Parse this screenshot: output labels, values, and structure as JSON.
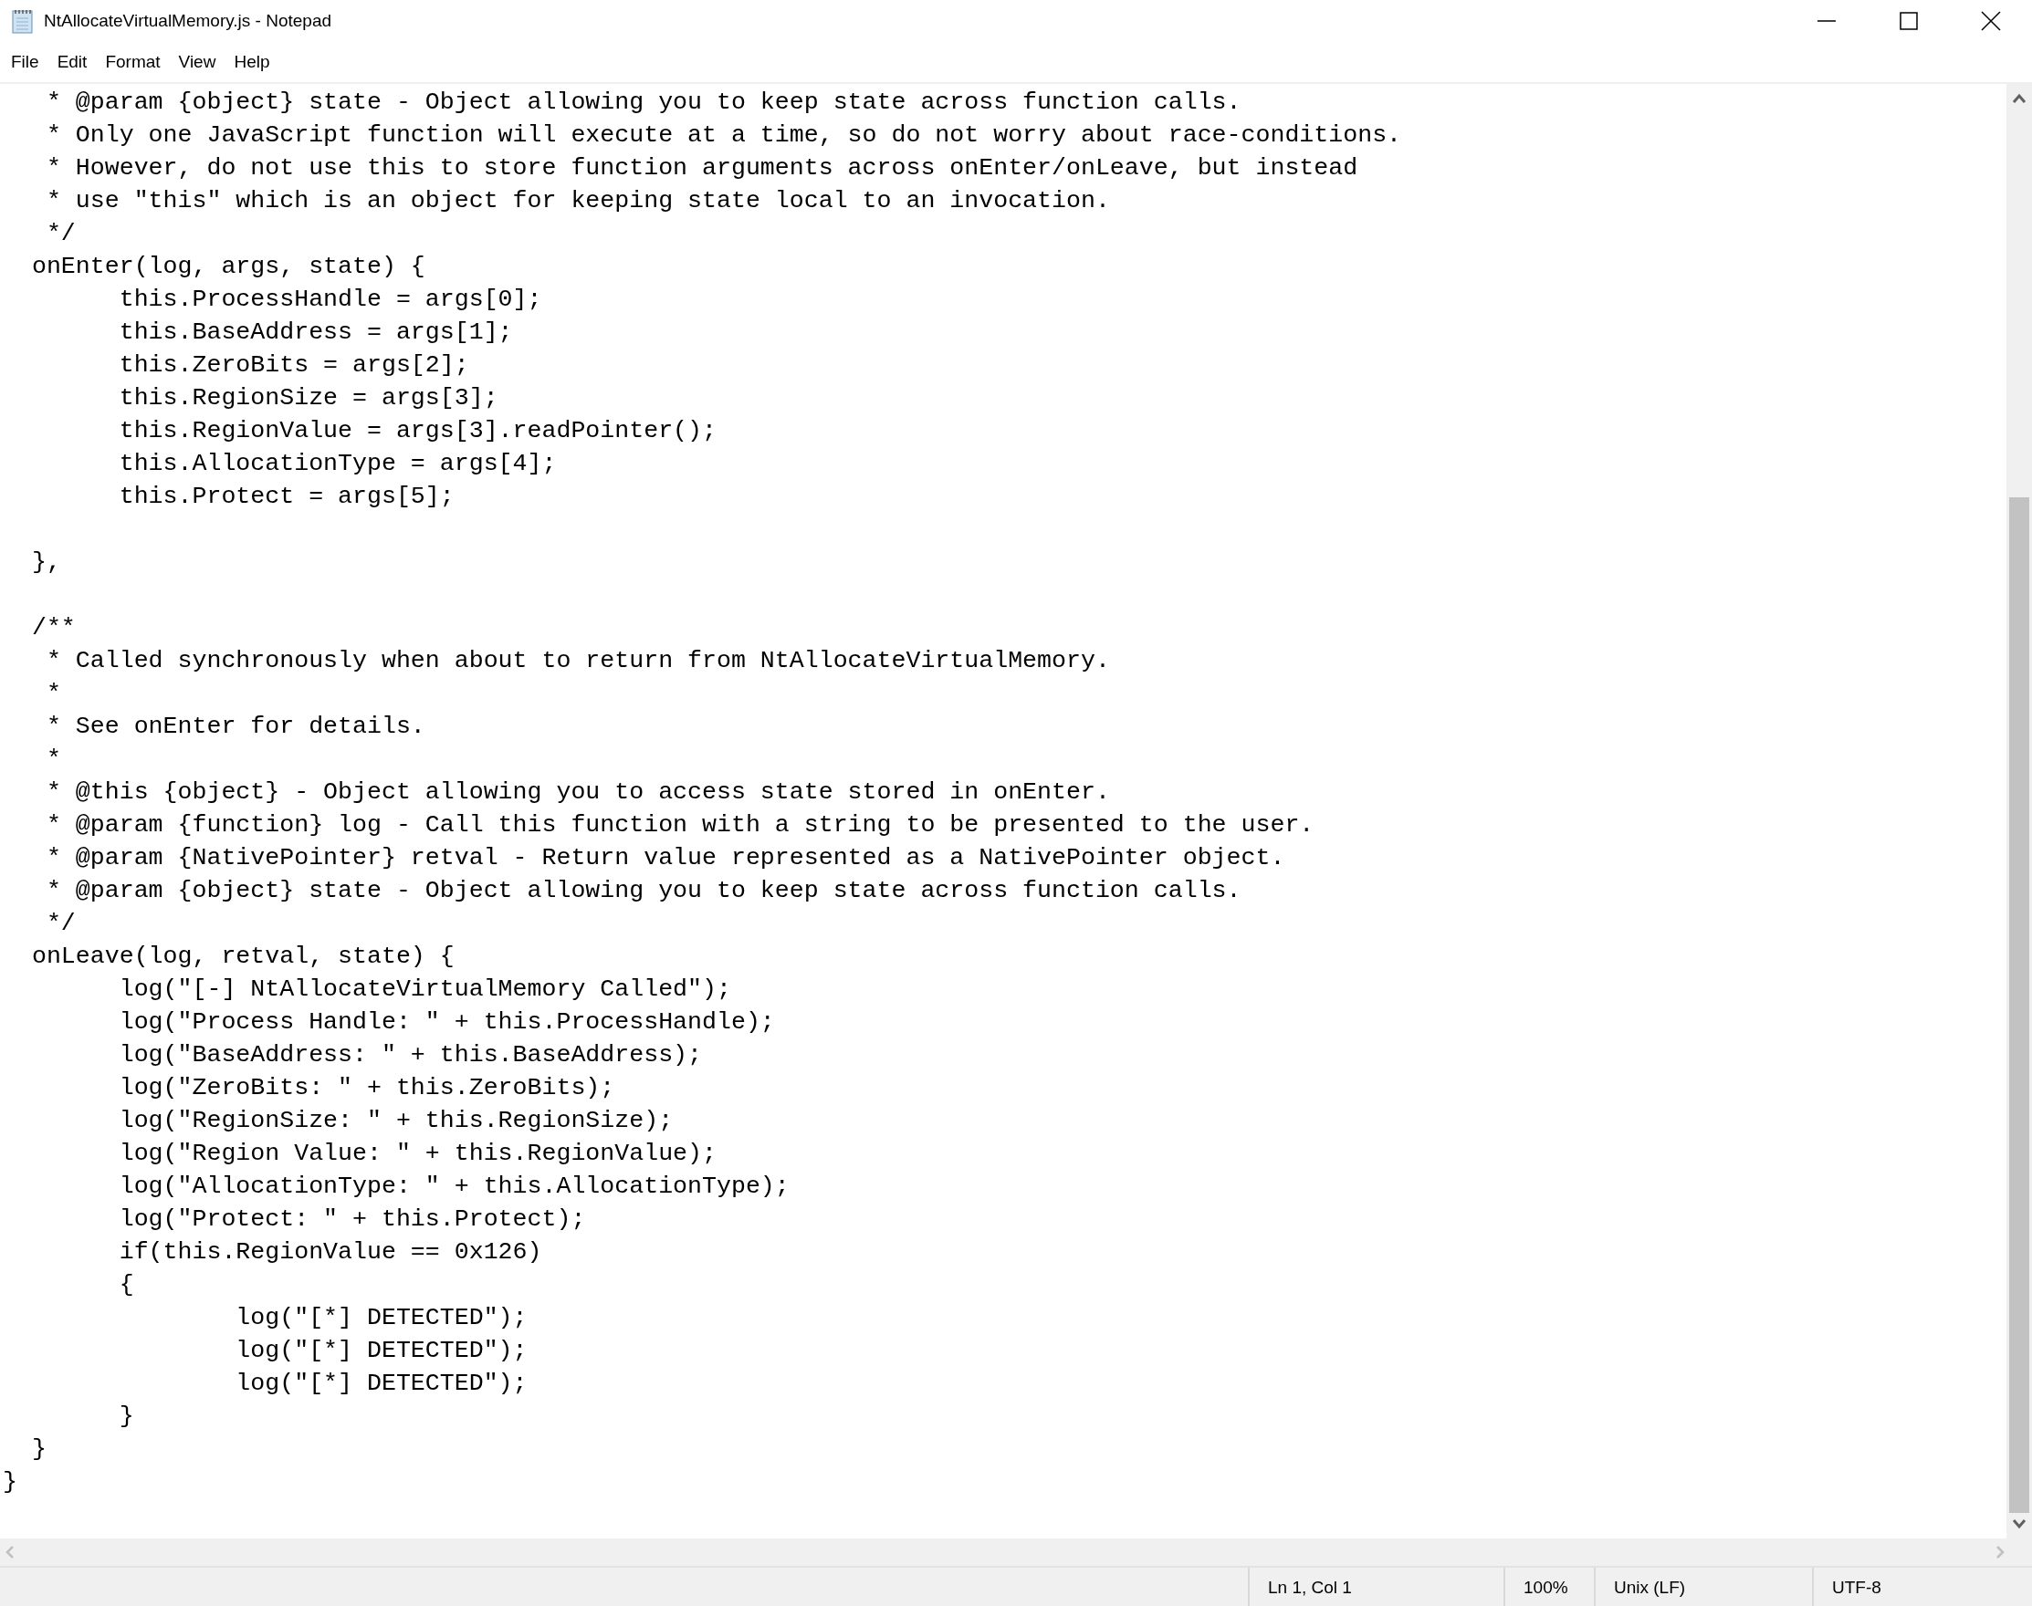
{
  "window": {
    "title": "NtAllocateVirtualMemory.js - Notepad"
  },
  "menu": [
    "File",
    "Edit",
    "Format",
    "View",
    "Help"
  ],
  "editor": {
    "lines": [
      {
        "text": "   * @param {object} state - Object allowing you to keep state across function calls."
      },
      {
        "text": "   * Only one JavaScript function will execute at a time, so do not worry about race-conditions."
      },
      {
        "text": "   * However, do not use this to store function arguments across onEnter/onLeave, but instead"
      },
      {
        "text": "   * use \"this\" which is an object for keeping state local to an invocation."
      },
      {
        "text": "   */"
      },
      {
        "text": "  onEnter(log, args, state) {"
      },
      {
        "text": "        this.ProcessHandle = args[0];"
      },
      {
        "text": "        this.BaseAddress = args[1];"
      },
      {
        "text": "        this.ZeroBits = args[2];"
      },
      {
        "text": "        this.RegionSize = args[3];"
      },
      {
        "text": "        this.RegionValue = args[3].readPointer();"
      },
      {
        "text": "        this.AllocationType = args[4];"
      },
      {
        "text": "        this.Protect = args[5];"
      },
      {
        "text": "  },",
        "gap_before": true
      },
      {
        "text": "  /**",
        "gap_before": true
      },
      {
        "text": "   * Called synchronously when about to return from NtAllocateVirtualMemory."
      },
      {
        "text": "   *"
      },
      {
        "text": "   * See onEnter for details."
      },
      {
        "text": "   *"
      },
      {
        "text": "   * @this {object} - Object allowing you to access state stored in onEnter."
      },
      {
        "text": "   * @param {function} log - Call this function with a string to be presented to the user."
      },
      {
        "text": "   * @param {NativePointer} retval - Return value represented as a NativePointer object."
      },
      {
        "text": "   * @param {object} state - Object allowing you to keep state across function calls."
      },
      {
        "text": "   */"
      },
      {
        "text": "  onLeave(log, retval, state) {"
      },
      {
        "text": "        log(\"[-] NtAllocateVirtualMemory Called\");"
      },
      {
        "text": "        log(\"Process Handle: \" + this.ProcessHandle);"
      },
      {
        "text": "        log(\"BaseAddress: \" + this.BaseAddress);"
      },
      {
        "text": "        log(\"ZeroBits: \" + this.ZeroBits);"
      },
      {
        "text": "        log(\"RegionSize: \" + this.RegionSize);"
      },
      {
        "text": "        log(\"Region Value: \" + this.RegionValue);"
      },
      {
        "text": "        log(\"AllocationType: \" + this.AllocationType);"
      },
      {
        "text": "        log(\"Protect: \" + this.Protect);"
      },
      {
        "text": "        if(this.RegionValue == 0x126)"
      },
      {
        "text": "        {"
      },
      {
        "text": "                log(\"[*] DETECTED\");"
      },
      {
        "text": "                log(\"[*] DETECTED\");"
      },
      {
        "text": "                log(\"[*] DETECTED\");"
      },
      {
        "text": "        }"
      },
      {
        "text": "  }"
      },
      {
        "text": "}"
      }
    ]
  },
  "status_bar": {
    "position": "Ln 1, Col 1",
    "zoom": "100%",
    "line_ending": "Unix (LF)",
    "encoding": "UTF-8"
  }
}
